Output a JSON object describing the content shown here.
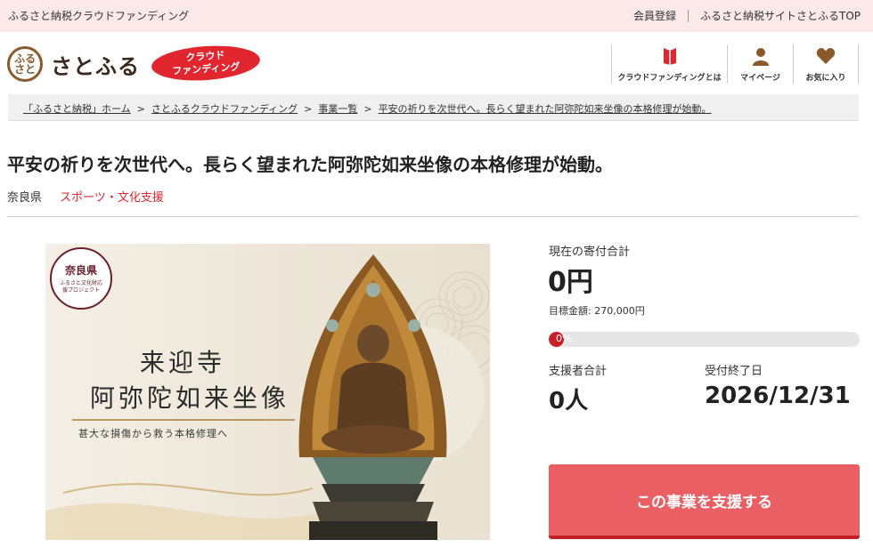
{
  "topbar": {
    "site_desc": "ふるさと納税クラウドファンディング",
    "links": [
      "会員登録",
      "ふるさと納税サイトさとふるTOP"
    ]
  },
  "header": {
    "logo_mark": "ふるさと",
    "logo_text": "さとふる",
    "cf_badge_line1": "クラウド",
    "cf_badge_line2": "ファンディング",
    "nav": [
      {
        "label": "クラウドファンディングとは",
        "icon": "book-icon"
      },
      {
        "label": "マイページ",
        "icon": "user-icon"
      },
      {
        "label": "お気に入り",
        "icon": "heart-icon"
      }
    ]
  },
  "breadcrumb": [
    "「ふるさと納税」ホーム",
    "さとふるクラウドファンディング",
    "事業一覧",
    "平安の祈りを次世代へ。長らく望まれた阿弥陀如来坐像の本格修理が始動。"
  ],
  "breadcrumb_sep": ">",
  "project": {
    "title": "平安の祈りを次世代へ。長らく望まれた阿弥陀如来坐像の本格修理が始動。",
    "prefecture": "奈良県",
    "category": "スポーツ・文化支援"
  },
  "hero": {
    "seal_title": "奈良県",
    "seal_sub": "ふるさと文化財応援プロジェクト",
    "heading1": "来迎寺",
    "heading2": "阿弥陀如来坐像",
    "subheading": "甚大な損傷から救う本格修理へ"
  },
  "stats": {
    "total_label": "現在の寄付合計",
    "total_value": "0円",
    "goal_text": "目標金額: 270,000円",
    "progress_percent": 0,
    "progress_text": "0%",
    "supporters_label": "支援者合計",
    "supporters_value": "0人",
    "deadline_label": "受付終了日",
    "deadline_value": "2026/12/31"
  },
  "cta": {
    "label": "この事業を支援する"
  },
  "colors": {
    "accent": "#e2262f",
    "button": "#e95f63",
    "topbar_bg": "#fbe8e9",
    "brand_brown": "#8a5a2b"
  }
}
